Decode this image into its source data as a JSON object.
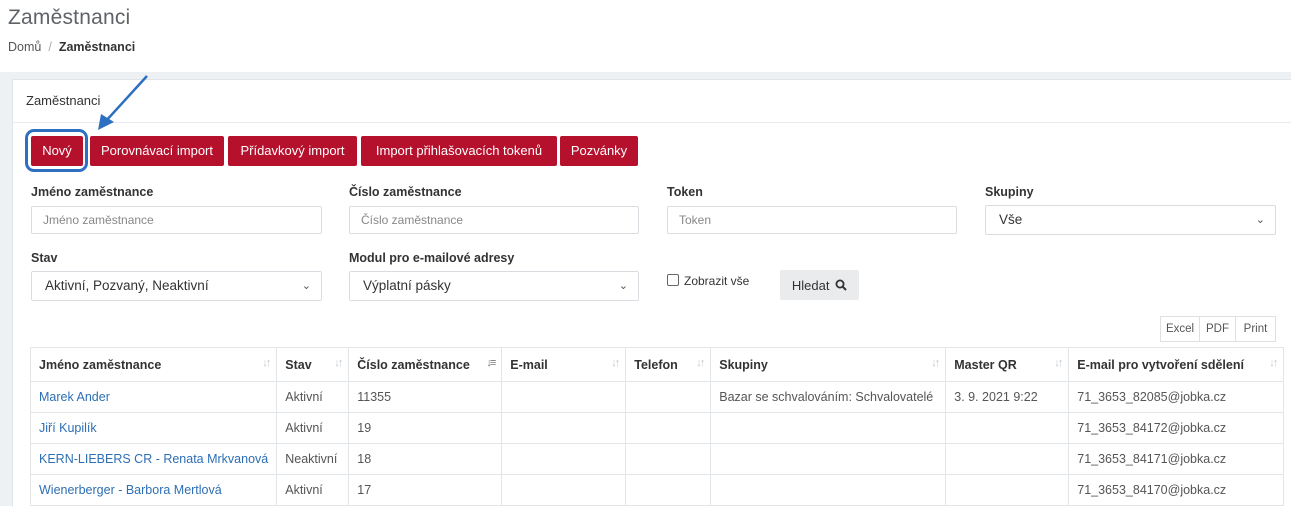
{
  "page": {
    "title": "Zaměstnanci"
  },
  "breadcrumb": {
    "home": "Domů",
    "separator": "/",
    "current": "Zaměstnanci"
  },
  "card": {
    "title": "Zaměstnanci"
  },
  "toolbar": {
    "new": "Nový",
    "compare_import": "Porovnávací import",
    "append_import": "Přídavkový import",
    "token_import": "Import přihlašovacích tokenů",
    "invitations": "Pozvánky"
  },
  "filters": {
    "name": {
      "label": "Jméno zaměstnance",
      "placeholder": "Jméno zaměstnance"
    },
    "number": {
      "label": "Číslo zaměstnance",
      "placeholder": "Číslo zaměstnance"
    },
    "token": {
      "label": "Token",
      "placeholder": "Token"
    },
    "groups": {
      "label": "Skupiny",
      "value": "Vše"
    },
    "state": {
      "label": "Stav",
      "value": "Aktivní, Pozvaný, Neaktivní"
    },
    "email_module": {
      "label": "Modul pro e-mailové adresy",
      "value": "Výplatní pásky"
    },
    "show_all": {
      "label": "Zobrazit vše",
      "checked": false
    },
    "search": "Hledat"
  },
  "export": {
    "excel": "Excel",
    "pdf": "PDF",
    "print": "Print"
  },
  "table": {
    "columns": [
      "Jméno zaměstnance",
      "Stav",
      "Číslo zaměstnance",
      "E-mail",
      "Telefon",
      "Skupiny",
      "Master QR",
      "E-mail pro vytvoření sdělení"
    ],
    "rows": [
      {
        "name": "Marek Ander",
        "state": "Aktivní",
        "number": "11355",
        "email": "",
        "phone": "",
        "groups": "Bazar se schvalováním: Schvalovatelé",
        "master_qr": "3. 9. 2021 9:22",
        "message_email": "71_3653_82085@jobka.cz"
      },
      {
        "name": "Jiří Kupilík",
        "state": "Aktivní",
        "number": "19",
        "email": "",
        "phone": "",
        "groups": "",
        "master_qr": "",
        "message_email": "71_3653_84172@jobka.cz"
      },
      {
        "name": "KERN-LIEBERS CR - Renata Mrkvanová",
        "state": "Neaktivní",
        "number": "18",
        "email": "",
        "phone": "",
        "groups": "",
        "master_qr": "",
        "message_email": "71_3653_84171@jobka.cz"
      },
      {
        "name": "Wienerberger - Barbora Mertlová",
        "state": "Aktivní",
        "number": "17",
        "email": "",
        "phone": "",
        "groups": "",
        "master_qr": "",
        "message_email": "71_3653_84170@jobka.cz"
      }
    ]
  },
  "colors": {
    "primary": "#b5102c",
    "annotation": "#2d6fc0",
    "link": "#2d6fb5"
  },
  "icons": {
    "search": "search-icon",
    "chevron": "chevron-down-icon",
    "sort": "sort-icon"
  }
}
